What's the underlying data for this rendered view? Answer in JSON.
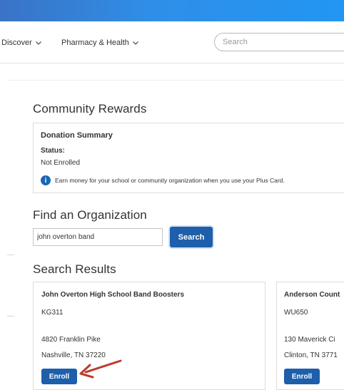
{
  "nav": {
    "discover_label": "Discover",
    "pharmacy_label": "Pharmacy & Health",
    "search_placeholder": "Search"
  },
  "page": {
    "title": "Community Rewards"
  },
  "summary": {
    "heading": "Donation Summary",
    "status_label": "Status:",
    "status_value": "Not Enrolled",
    "info_text": "Earn money for your school or community organization when you use your Plus Card."
  },
  "find": {
    "heading": "Find an Organization",
    "input_value": "john overton band",
    "button_label": "Search"
  },
  "results": {
    "heading": "Search Results",
    "items": [
      {
        "name": "John Overton High School Band Boosters",
        "code": "KG311",
        "address": "4820 Franklin Pike",
        "city": "Nashville, TN 37220",
        "button": "Enroll"
      },
      {
        "name": "Anderson Count",
        "code": "WU650",
        "address": "130 Maverick Ci",
        "city": "Clinton, TN 3771",
        "button": "Enroll"
      }
    ]
  },
  "colors": {
    "accent": "#1d5faa",
    "annotation_arrow": "#c0392b"
  },
  "icons": {
    "info": "info-icon",
    "chevron": "chevron-down-icon"
  }
}
